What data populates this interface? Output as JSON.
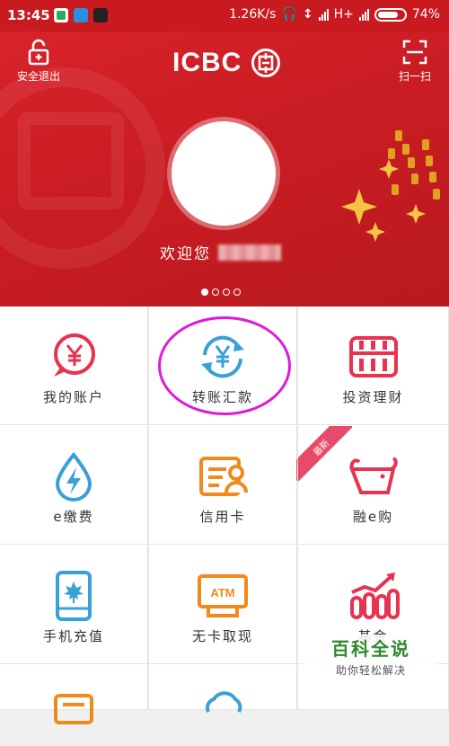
{
  "status_bar": {
    "time": "13:45",
    "speed": "1.26K/s",
    "network": "H+",
    "battery": "74%"
  },
  "header": {
    "lock_label": "安全退出",
    "brand": "ICBC",
    "scan_label": "扫一扫"
  },
  "welcome": {
    "text": "欢迎您"
  },
  "carousel": {
    "page_count": 4,
    "active_index": 0
  },
  "grid": {
    "items": [
      {
        "label": "我的账户",
        "icon": "yen-chat-icon",
        "color": "#e8324f"
      },
      {
        "label": "转账汇款",
        "icon": "yen-transfer-icon",
        "color": "#3aa0d8"
      },
      {
        "label": "投资理财",
        "icon": "abacus-icon",
        "color": "#e8324f"
      },
      {
        "label": "e缴费",
        "icon": "water-drop-bolt-icon",
        "color": "#3aa0d8"
      },
      {
        "label": "信用卡",
        "icon": "credit-card-icon",
        "color": "#f08a1c"
      },
      {
        "label": "融e购",
        "icon": "shopping-bag-icon",
        "color": "#e8324f",
        "badge": "最新"
      },
      {
        "label": "手机充值",
        "icon": "phone-maple-icon",
        "color": "#3aa0d8"
      },
      {
        "label": "无卡取现",
        "icon": "atm-icon",
        "color": "#f08a1c",
        "atm_text": "ATM"
      },
      {
        "label": "基金",
        "icon": "bar-chart-icon",
        "color": "#e8324f"
      },
      {
        "label": "",
        "icon": "partial-orange-icon",
        "color": "#f08a1c"
      },
      {
        "label": "",
        "icon": "partial-cloud-icon",
        "color": "#3aa0d8"
      },
      {
        "label": "",
        "icon": "partial-red-icon",
        "color": "#e8324f"
      }
    ]
  },
  "watermark": {
    "title": "百科全说",
    "subtitle": "助你轻松解决"
  }
}
